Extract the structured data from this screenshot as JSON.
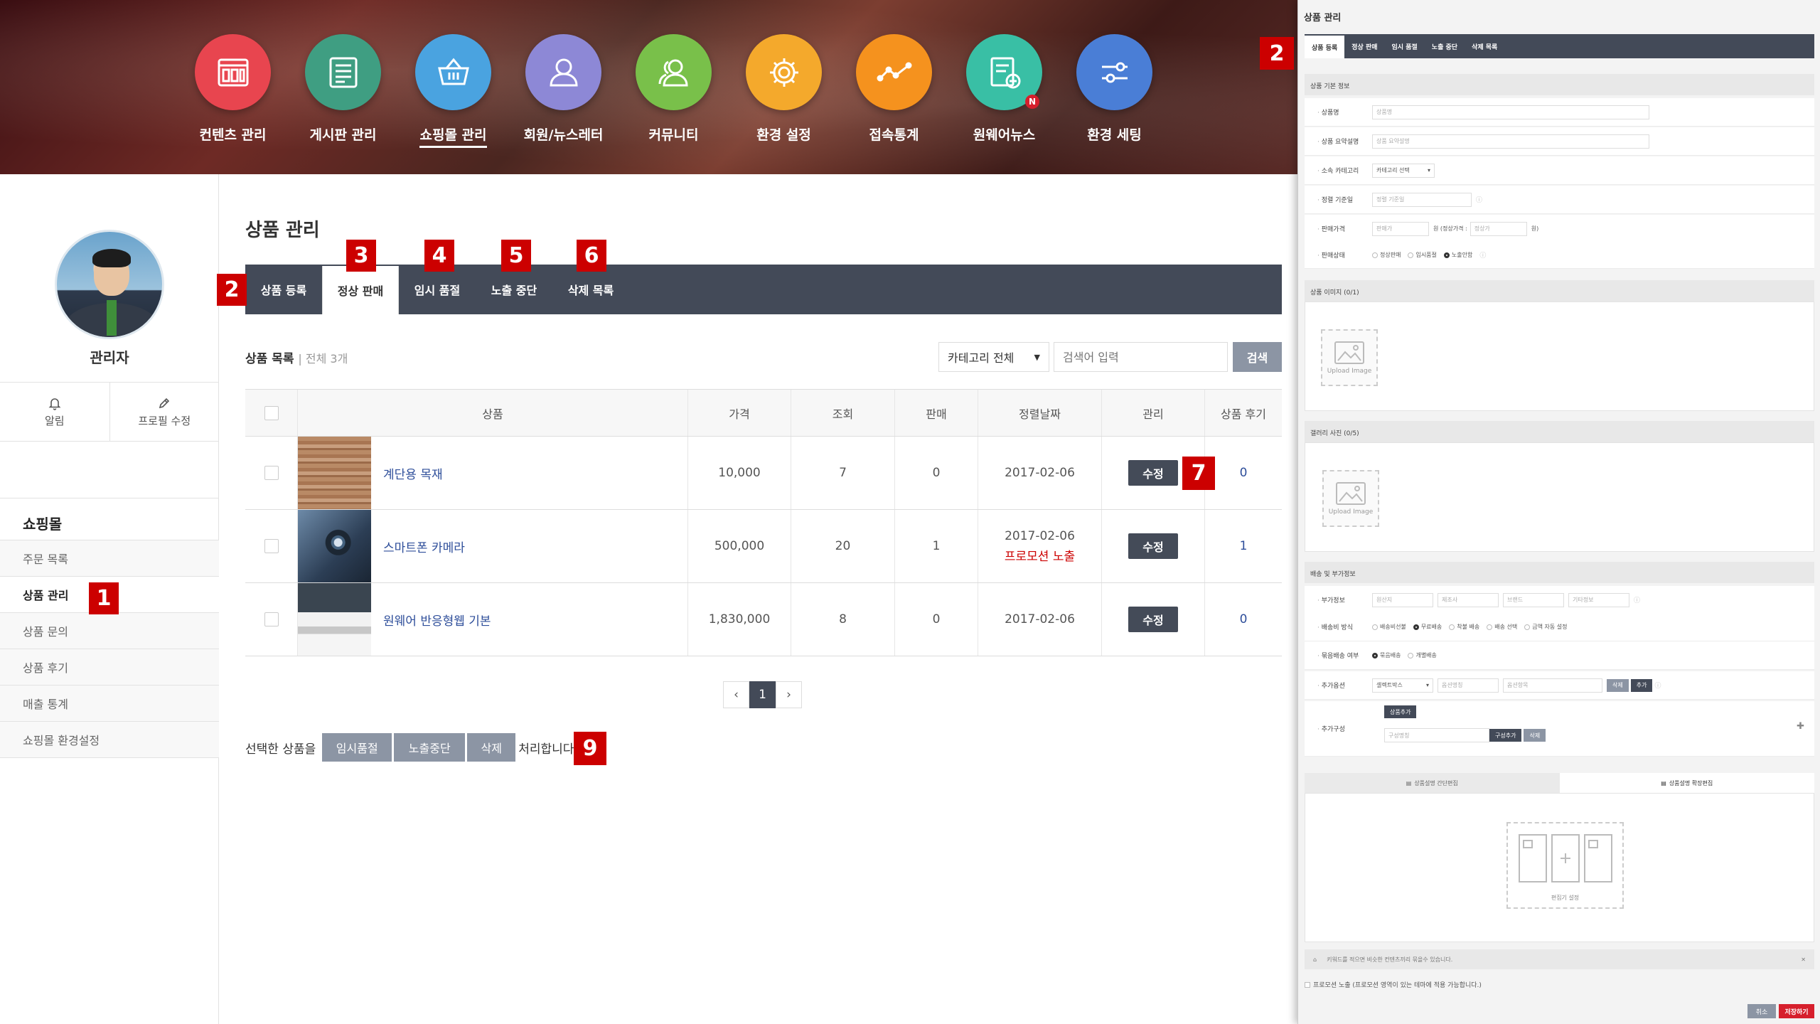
{
  "header": {
    "menu": [
      {
        "label": "컨텐츠 관리",
        "icon": "content-window-icon",
        "color": "#e8454f"
      },
      {
        "label": "게시판 관리",
        "icon": "list-icon",
        "color": "#3f9e82"
      },
      {
        "label": "쇼핑몰 관리",
        "icon": "basket-icon",
        "color": "#4aa3e0",
        "active": true
      },
      {
        "label": "회원/뉴스레터",
        "icon": "user-icon",
        "color": "#8d88d6"
      },
      {
        "label": "커뮤니티",
        "icon": "users-icon",
        "color": "#79c04a"
      },
      {
        "label": "환경 설정",
        "icon": "gear-icon",
        "color": "#f4a92c"
      },
      {
        "label": "접속통계",
        "icon": "chart-line-icon",
        "color": "#f5921e"
      },
      {
        "label": "원웨어뉴스",
        "icon": "news-icon",
        "color": "#39bfa5",
        "badge": "N"
      },
      {
        "label": "환경 세팅",
        "icon": "sliders-icon",
        "color": "#4a7ed6"
      }
    ]
  },
  "sidebar": {
    "user_name": "관리자",
    "actions": {
      "alarm": "알림",
      "profile_edit": "프로필 수정"
    },
    "section_title": "쇼핑몰",
    "items": [
      "주문 목록",
      "상품 관리",
      "상품 문의",
      "상품 후기",
      "매출 통계",
      "쇼핑몰 환경설정"
    ]
  },
  "main": {
    "title": "상품 관리",
    "tabs": [
      "상품 등록",
      "정상 판매",
      "임시 품절",
      "노출 중단",
      "삭제 목록"
    ],
    "list_label": "상품 목록",
    "list_count": "| 전체 3개",
    "category_select": "카테고리 전체",
    "search_placeholder": "검색어 입력",
    "search_button": "검색",
    "columns": [
      "상품",
      "가격",
      "조회",
      "판매",
      "정렬날짜",
      "관리",
      "상품 후기"
    ],
    "rows": [
      {
        "name": "계단용 목재",
        "price": "10,000",
        "views": "7",
        "sales": "0",
        "date": "2017-02-06",
        "promo": "",
        "edit": "수정",
        "reviews": "0"
      },
      {
        "name": "스마트폰 카메라",
        "price": "500,000",
        "views": "20",
        "sales": "1",
        "date": "2017-02-06",
        "promo": "프로모션 노출",
        "edit": "수정",
        "reviews": "1"
      },
      {
        "name": "원웨어 반응형웹 기본",
        "price": "1,830,000",
        "views": "8",
        "sales": "0",
        "date": "2017-02-06",
        "promo": "",
        "edit": "수정",
        "reviews": "0"
      }
    ],
    "pagination": {
      "prev": "‹",
      "current": "1",
      "next": "›"
    },
    "bulk": {
      "prefix": "선택한 상품을",
      "buttons": [
        "임시품절",
        "노출중단",
        "삭제"
      ],
      "suffix": "처리합니다."
    }
  },
  "callouts": [
    "1",
    "2",
    "3",
    "4",
    "5",
    "6",
    "7",
    "9",
    "2"
  ],
  "right_panel": {
    "title": "상품 관리",
    "tabs": [
      "상품 등록",
      "정상 판매",
      "임시 품절",
      "노출 중단",
      "삭제 목록"
    ],
    "basic_info_title": "상품 기본 정보",
    "fields": {
      "name_label": "상품명",
      "name_placeholder": "상품명",
      "summary_label": "상품 요약설명",
      "summary_placeholder": "상품 요약설명",
      "category_label": "소속 카테고리",
      "category_value": "카테고리 선택",
      "sortdate_label": "정렬 기준일",
      "sortdate_placeholder": "정렬 기준일",
      "price_label": "판매가격",
      "price_placeholder": "판매가",
      "price_mid": "원 (정상가격 :",
      "list_price_placeholder": "정상가",
      "price_end": "원)",
      "status_label": "판매상태",
      "status_options": [
        "정상판매",
        "임시품절",
        "노출안함"
      ]
    },
    "image_title": "상품 이미지 (0/1)",
    "gallery_title": "갤러리 사진 (0/5)",
    "upload_label": "Upload Image",
    "shipping_title": "배송 및 부가정보",
    "extra_label": "부가정보",
    "extra_placeholders": [
      "원산지",
      "제조사",
      "브랜드",
      "기타정보"
    ],
    "shipfee_label": "배송비 방식",
    "shipfee_options": [
      "배송비선불",
      "무료배송",
      "착불 배송",
      "배송 선택",
      "금액 자동 설정"
    ],
    "bundle_label": "묶음배송 여부",
    "bundle_options": [
      "묶음배송",
      "개별배송"
    ],
    "option_label": "추가옵션",
    "option_select": "셀렉트박스",
    "option_name_placeholder": "옵션명칭",
    "option_item_placeholder": "옵션항목",
    "option_delete": "삭제",
    "option_add": "추가",
    "compose_label": "추가구성",
    "compose_add_product": "상품추가",
    "compose_name_placeholder": "구성명칭",
    "compose_add": "구성추가",
    "compose_delete": "삭제",
    "editor_tabs": [
      "상품설명 간단편집",
      "상품설명 확장편집"
    ],
    "editor_settings": "편집기 설정",
    "keyword_text": "키워드를 적으면 비슷한 컨텐츠끼리 묶을수 있습니다.",
    "promo_text": "프로모션 노출 (프로모션 영역이 있는 테마에 적용 가능합니다.)",
    "cancel": "취소",
    "save": "저장하기"
  }
}
